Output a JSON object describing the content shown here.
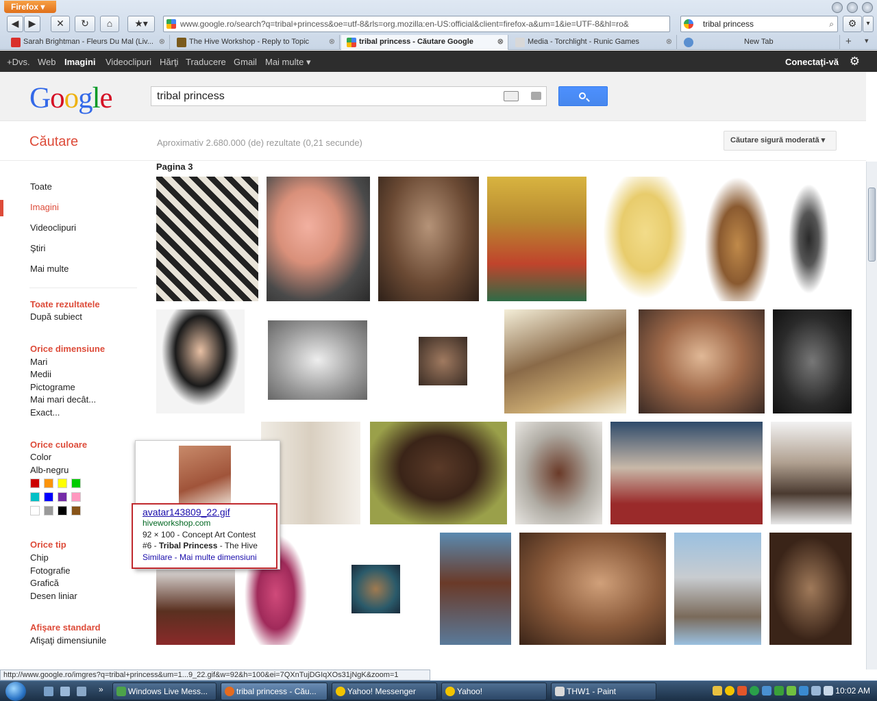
{
  "browser": {
    "app_button": "Firefox",
    "url": "www.google.ro/search?q=tribal+princess&oe=utf-8&rls=org.mozilla:en-US:official&client=firefox-a&um=1&ie=UTF-8&hl=ro&",
    "search_box": "tribal princess",
    "tabs": [
      {
        "label": "Sarah Brightman - Fleurs Du Mal (Liv...",
        "color": "#d9302c"
      },
      {
        "label": "The Hive Workshop - Reply to Topic",
        "color": "#7a5a1c"
      },
      {
        "label": "tribal princess - Căutare Google",
        "color": "#4285f4"
      },
      {
        "label": "Media - Torchlight - Runic Games",
        "color": "#d8d8d8"
      },
      {
        "label": "New Tab",
        "color": "#5a8fd0"
      }
    ]
  },
  "gbar": {
    "items": [
      "+Dvs.",
      "Web",
      "Imagini",
      "Videoclipuri",
      "Hărţi",
      "Traducere",
      "Gmail",
      "Mai multe ▾"
    ],
    "login": "Conectaţi-vă"
  },
  "search": {
    "logo": "Google",
    "query": "tribal princess",
    "section_title": "Căutare",
    "stats": "Aproximativ 2.680.000 (de) rezultate (0,21 secunde)",
    "safe_search": "Căutare sigură moderată ▾",
    "page_label": "Pagina 3"
  },
  "sidebar": {
    "nav": [
      "Toate",
      "Imagini",
      "Videoclipuri",
      "Ştiri",
      "Mai multe"
    ],
    "all_results_head": "Toate rezultatele",
    "all_results_item": "După subiect",
    "size_head": "Orice dimensiune",
    "size_items": [
      "Mari",
      "Medii",
      "Pictograme",
      "Mai mari decât...",
      "Exact..."
    ],
    "color_head": "Orice culoare",
    "color_items": [
      "Color",
      "Alb-negru"
    ],
    "swatches": [
      "#cc0000",
      "#fb940b",
      "#ffff00",
      "#00cc00",
      "#03c0c6",
      "#0000ff",
      "#762ca7",
      "#ff98bf",
      "#ffffff",
      "#999999",
      "#000000",
      "#885418"
    ],
    "type_head": "Orice tip",
    "type_items": [
      "Chip",
      "Fotografie",
      "Grafică",
      "Desen liniar"
    ],
    "display_head": "Afişare standard",
    "display_item": "Afişaţi dimensiunile"
  },
  "popup": {
    "title": "avatar143809_22.gif",
    "site": "hiveworkshop.com",
    "desc_1": "92 × 100 - Concept Art Contest",
    "desc_2a": "#6 - ",
    "desc_2b": "Tribal Princess",
    "desc_2c": " - The Hive",
    "links": "Similare - Mai multe dimensiuni"
  },
  "status_url": "http://www.google.ro/imgres?q=tribal+princess&um=1...9_22.gif&w=92&h=100&ei=7QXnTujDGIqXOs31jNgK&zoom=1",
  "taskbar": {
    "items": [
      {
        "label": "Windows Live Mess...",
        "color": "#4da34a"
      },
      {
        "label": "tribal princess - Cău...",
        "color": "#e56b1f"
      },
      {
        "label": "Yahoo! Messenger",
        "color": "#f2c400"
      },
      {
        "label": "Yahoo!",
        "color": "#f2c400"
      },
      {
        "label": "THW1 - Paint",
        "color": "#d9d9d9"
      }
    ],
    "clock": "10:02 AM"
  }
}
